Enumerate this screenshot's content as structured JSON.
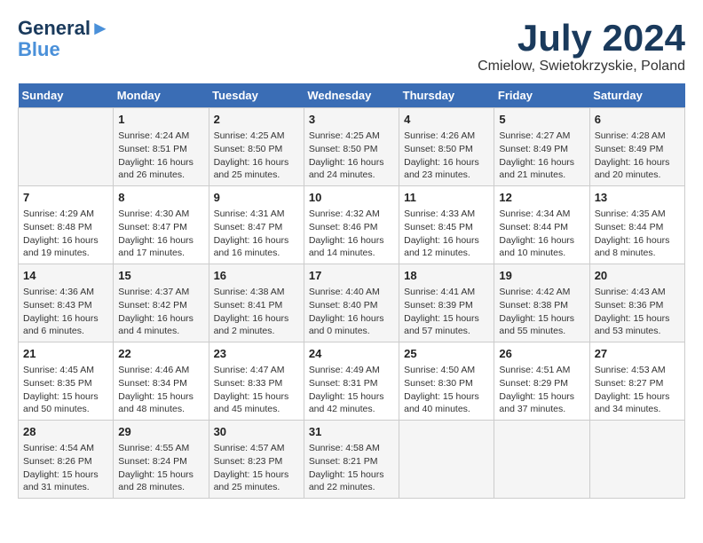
{
  "header": {
    "logo_line1": "General",
    "logo_line2": "Blue",
    "month_title": "July 2024",
    "location": "Cmielow, Swietokrzyskie, Poland"
  },
  "weekdays": [
    "Sunday",
    "Monday",
    "Tuesday",
    "Wednesday",
    "Thursday",
    "Friday",
    "Saturday"
  ],
  "weeks": [
    [
      {
        "day": "",
        "sunrise": "",
        "sunset": "",
        "daylight": ""
      },
      {
        "day": "1",
        "sunrise": "Sunrise: 4:24 AM",
        "sunset": "Sunset: 8:51 PM",
        "daylight": "Daylight: 16 hours and 26 minutes."
      },
      {
        "day": "2",
        "sunrise": "Sunrise: 4:25 AM",
        "sunset": "Sunset: 8:50 PM",
        "daylight": "Daylight: 16 hours and 25 minutes."
      },
      {
        "day": "3",
        "sunrise": "Sunrise: 4:25 AM",
        "sunset": "Sunset: 8:50 PM",
        "daylight": "Daylight: 16 hours and 24 minutes."
      },
      {
        "day": "4",
        "sunrise": "Sunrise: 4:26 AM",
        "sunset": "Sunset: 8:50 PM",
        "daylight": "Daylight: 16 hours and 23 minutes."
      },
      {
        "day": "5",
        "sunrise": "Sunrise: 4:27 AM",
        "sunset": "Sunset: 8:49 PM",
        "daylight": "Daylight: 16 hours and 21 minutes."
      },
      {
        "day": "6",
        "sunrise": "Sunrise: 4:28 AM",
        "sunset": "Sunset: 8:49 PM",
        "daylight": "Daylight: 16 hours and 20 minutes."
      }
    ],
    [
      {
        "day": "7",
        "sunrise": "Sunrise: 4:29 AM",
        "sunset": "Sunset: 8:48 PM",
        "daylight": "Daylight: 16 hours and 19 minutes."
      },
      {
        "day": "8",
        "sunrise": "Sunrise: 4:30 AM",
        "sunset": "Sunset: 8:47 PM",
        "daylight": "Daylight: 16 hours and 17 minutes."
      },
      {
        "day": "9",
        "sunrise": "Sunrise: 4:31 AM",
        "sunset": "Sunset: 8:47 PM",
        "daylight": "Daylight: 16 hours and 16 minutes."
      },
      {
        "day": "10",
        "sunrise": "Sunrise: 4:32 AM",
        "sunset": "Sunset: 8:46 PM",
        "daylight": "Daylight: 16 hours and 14 minutes."
      },
      {
        "day": "11",
        "sunrise": "Sunrise: 4:33 AM",
        "sunset": "Sunset: 8:45 PM",
        "daylight": "Daylight: 16 hours and 12 minutes."
      },
      {
        "day": "12",
        "sunrise": "Sunrise: 4:34 AM",
        "sunset": "Sunset: 8:44 PM",
        "daylight": "Daylight: 16 hours and 10 minutes."
      },
      {
        "day": "13",
        "sunrise": "Sunrise: 4:35 AM",
        "sunset": "Sunset: 8:44 PM",
        "daylight": "Daylight: 16 hours and 8 minutes."
      }
    ],
    [
      {
        "day": "14",
        "sunrise": "Sunrise: 4:36 AM",
        "sunset": "Sunset: 8:43 PM",
        "daylight": "Daylight: 16 hours and 6 minutes."
      },
      {
        "day": "15",
        "sunrise": "Sunrise: 4:37 AM",
        "sunset": "Sunset: 8:42 PM",
        "daylight": "Daylight: 16 hours and 4 minutes."
      },
      {
        "day": "16",
        "sunrise": "Sunrise: 4:38 AM",
        "sunset": "Sunset: 8:41 PM",
        "daylight": "Daylight: 16 hours and 2 minutes."
      },
      {
        "day": "17",
        "sunrise": "Sunrise: 4:40 AM",
        "sunset": "Sunset: 8:40 PM",
        "daylight": "Daylight: 16 hours and 0 minutes."
      },
      {
        "day": "18",
        "sunrise": "Sunrise: 4:41 AM",
        "sunset": "Sunset: 8:39 PM",
        "daylight": "Daylight: 15 hours and 57 minutes."
      },
      {
        "day": "19",
        "sunrise": "Sunrise: 4:42 AM",
        "sunset": "Sunset: 8:38 PM",
        "daylight": "Daylight: 15 hours and 55 minutes."
      },
      {
        "day": "20",
        "sunrise": "Sunrise: 4:43 AM",
        "sunset": "Sunset: 8:36 PM",
        "daylight": "Daylight: 15 hours and 53 minutes."
      }
    ],
    [
      {
        "day": "21",
        "sunrise": "Sunrise: 4:45 AM",
        "sunset": "Sunset: 8:35 PM",
        "daylight": "Daylight: 15 hours and 50 minutes."
      },
      {
        "day": "22",
        "sunrise": "Sunrise: 4:46 AM",
        "sunset": "Sunset: 8:34 PM",
        "daylight": "Daylight: 15 hours and 48 minutes."
      },
      {
        "day": "23",
        "sunrise": "Sunrise: 4:47 AM",
        "sunset": "Sunset: 8:33 PM",
        "daylight": "Daylight: 15 hours and 45 minutes."
      },
      {
        "day": "24",
        "sunrise": "Sunrise: 4:49 AM",
        "sunset": "Sunset: 8:31 PM",
        "daylight": "Daylight: 15 hours and 42 minutes."
      },
      {
        "day": "25",
        "sunrise": "Sunrise: 4:50 AM",
        "sunset": "Sunset: 8:30 PM",
        "daylight": "Daylight: 15 hours and 40 minutes."
      },
      {
        "day": "26",
        "sunrise": "Sunrise: 4:51 AM",
        "sunset": "Sunset: 8:29 PM",
        "daylight": "Daylight: 15 hours and 37 minutes."
      },
      {
        "day": "27",
        "sunrise": "Sunrise: 4:53 AM",
        "sunset": "Sunset: 8:27 PM",
        "daylight": "Daylight: 15 hours and 34 minutes."
      }
    ],
    [
      {
        "day": "28",
        "sunrise": "Sunrise: 4:54 AM",
        "sunset": "Sunset: 8:26 PM",
        "daylight": "Daylight: 15 hours and 31 minutes."
      },
      {
        "day": "29",
        "sunrise": "Sunrise: 4:55 AM",
        "sunset": "Sunset: 8:24 PM",
        "daylight": "Daylight: 15 hours and 28 minutes."
      },
      {
        "day": "30",
        "sunrise": "Sunrise: 4:57 AM",
        "sunset": "Sunset: 8:23 PM",
        "daylight": "Daylight: 15 hours and 25 minutes."
      },
      {
        "day": "31",
        "sunrise": "Sunrise: 4:58 AM",
        "sunset": "Sunset: 8:21 PM",
        "daylight": "Daylight: 15 hours and 22 minutes."
      },
      {
        "day": "",
        "sunrise": "",
        "sunset": "",
        "daylight": ""
      },
      {
        "day": "",
        "sunrise": "",
        "sunset": "",
        "daylight": ""
      },
      {
        "day": "",
        "sunrise": "",
        "sunset": "",
        "daylight": ""
      }
    ]
  ]
}
